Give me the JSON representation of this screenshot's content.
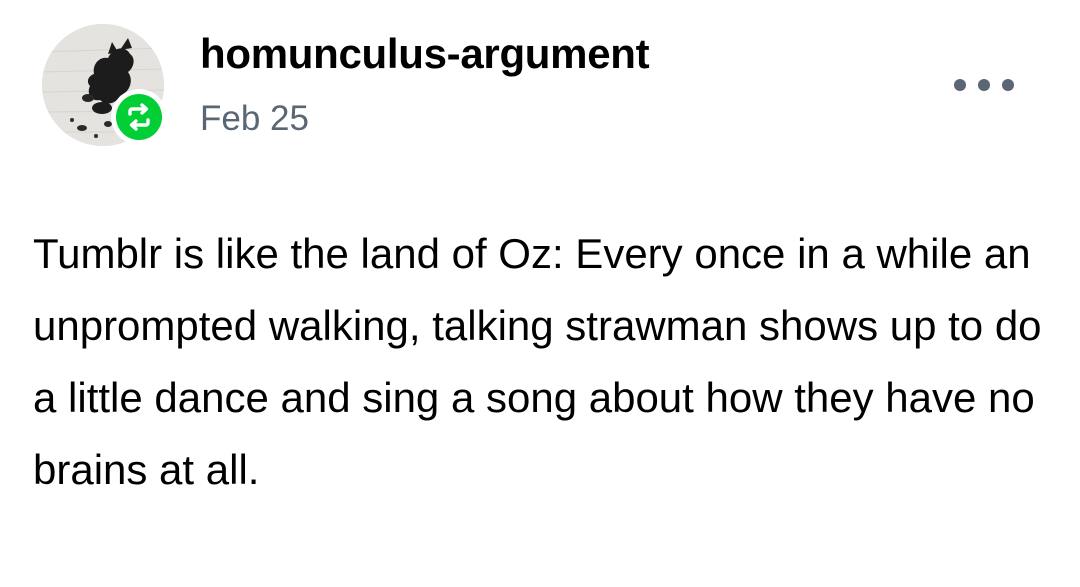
{
  "post": {
    "author": {
      "username": "homunculus-argument",
      "avatar_icon": "avatar-image",
      "badge_icon": "reblog-icon",
      "badge_color": "#01cf35"
    },
    "timestamp": "Feb 25",
    "menu_icon": "more-options-icon",
    "body_text": "Tumblr is like the land of Oz: Every once in a while an unprompted walking, talking strawman shows up to do a little dance and sing a song about how they have no brains at all."
  },
  "colors": {
    "text": "#000000",
    "secondary_text": "#5a6673",
    "background": "#ffffff",
    "accent": "#01cf35"
  }
}
